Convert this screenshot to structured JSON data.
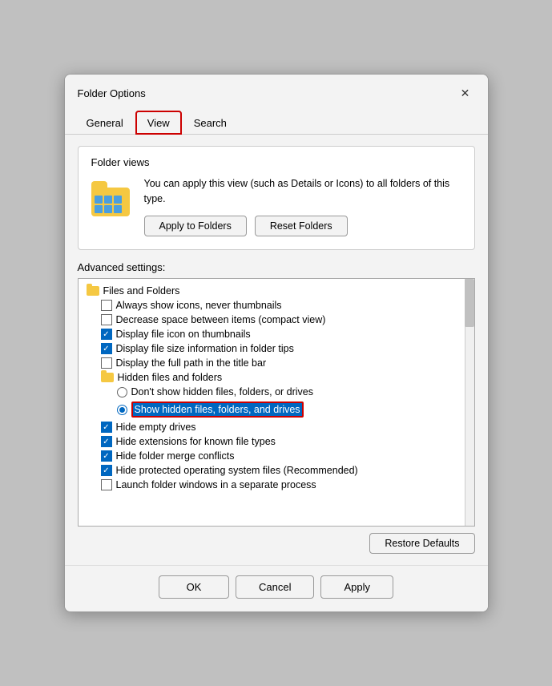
{
  "dialog": {
    "title": "Folder Options",
    "close_label": "✕"
  },
  "tabs": [
    {
      "label": "General",
      "active": false
    },
    {
      "label": "View",
      "active": true
    },
    {
      "label": "Search",
      "active": false
    }
  ],
  "folder_views": {
    "section_title": "Folder views",
    "description": "You can apply this view (such as Details or Icons) to all folders of this type.",
    "apply_button": "Apply to Folders",
    "reset_button": "Reset Folders"
  },
  "advanced": {
    "label": "Advanced settings:",
    "category": "Files and Folders",
    "items": [
      {
        "type": "checkbox",
        "checked": false,
        "label": "Always show icons, never thumbnails"
      },
      {
        "type": "checkbox",
        "checked": false,
        "label": "Decrease space between items (compact view)"
      },
      {
        "type": "checkbox",
        "checked": true,
        "label": "Display file icon on thumbnails"
      },
      {
        "type": "checkbox",
        "checked": true,
        "label": "Display file size information in folder tips"
      },
      {
        "type": "checkbox",
        "checked": false,
        "label": "Display the full path in the title bar"
      },
      {
        "type": "folder",
        "label": "Hidden files and folders"
      },
      {
        "type": "radio",
        "checked": false,
        "label": "Don't show hidden files, folders, or drives"
      },
      {
        "type": "radio",
        "checked": true,
        "label": "Show hidden files, folders, and drives",
        "highlighted": true
      },
      {
        "type": "checkbox",
        "checked": true,
        "label": "Hide empty drives"
      },
      {
        "type": "checkbox",
        "checked": true,
        "label": "Hide extensions for known file types"
      },
      {
        "type": "checkbox",
        "checked": true,
        "label": "Hide folder merge conflicts"
      },
      {
        "type": "checkbox",
        "checked": true,
        "label": "Hide protected operating system files (Recommended)"
      },
      {
        "type": "checkbox",
        "checked": false,
        "label": "Launch folder windows in a separate process"
      }
    ],
    "restore_button": "Restore Defaults"
  },
  "bottom_buttons": {
    "ok": "OK",
    "cancel": "Cancel",
    "apply": "Apply"
  }
}
